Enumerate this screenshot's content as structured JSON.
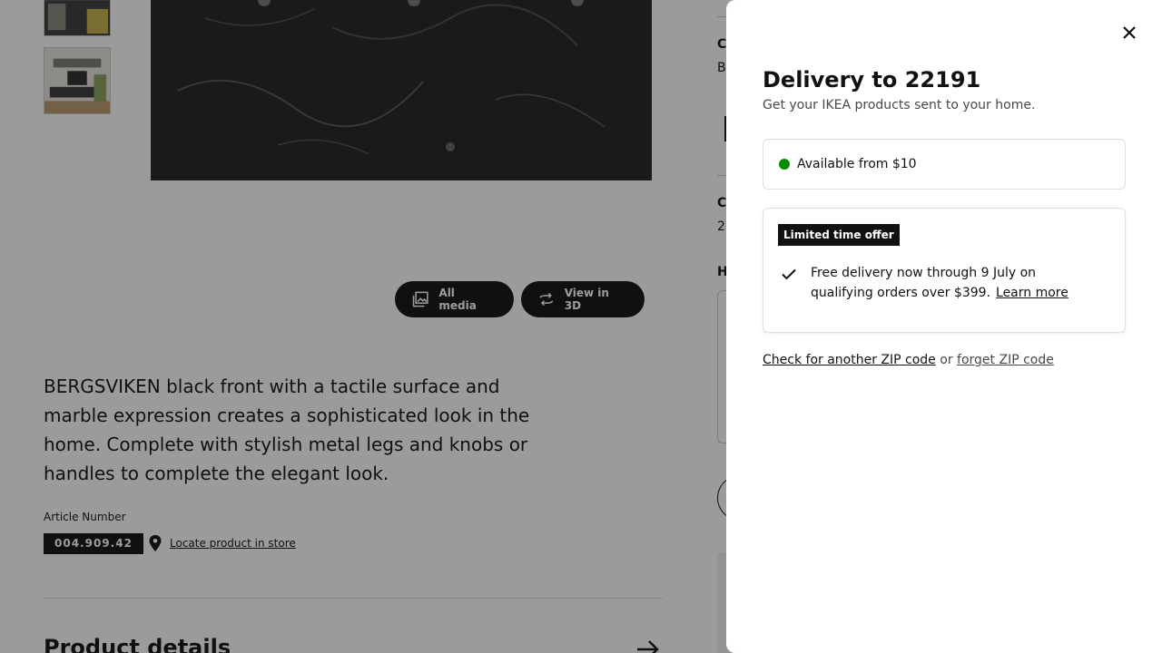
{
  "background": {
    "media_buttons": {
      "all_media": "All media",
      "view_3d": "View in 3D"
    },
    "description": "BERGSVIKEN black front with a tactile surface and marble expression creates a sophisticated look in the home. Complete with stylish metal legs and knobs or handles to complete the elegant look.",
    "article_label": "Article Number",
    "article_number": "004.909.42",
    "locate_link": "Locate product in store",
    "product_details": "Product details",
    "right_panel": {
      "c1": "C",
      "b1": "B",
      "c2": "C",
      "n2": "2",
      "h": "H"
    }
  },
  "modal": {
    "title": "Delivery to 22191",
    "subtitle": "Get your IKEA products sent to your home.",
    "availability": {
      "text": "Available from $10",
      "status_color": "#0a8a00"
    },
    "offer": {
      "badge": "Limited time offer",
      "text": "Free delivery now through 9 July on qualifying orders over $399.",
      "link": "Learn more"
    },
    "zip": {
      "check_link": "Check for another ZIP code",
      "separator": "or",
      "forget_link": "forget ZIP code"
    }
  },
  "icons": {
    "close": "close-icon",
    "check": "check-icon",
    "location": "location-pin-icon",
    "gallery": "gallery-icon",
    "rotate_3d": "rotate-3d-icon",
    "arrow": "arrow-right-icon"
  }
}
